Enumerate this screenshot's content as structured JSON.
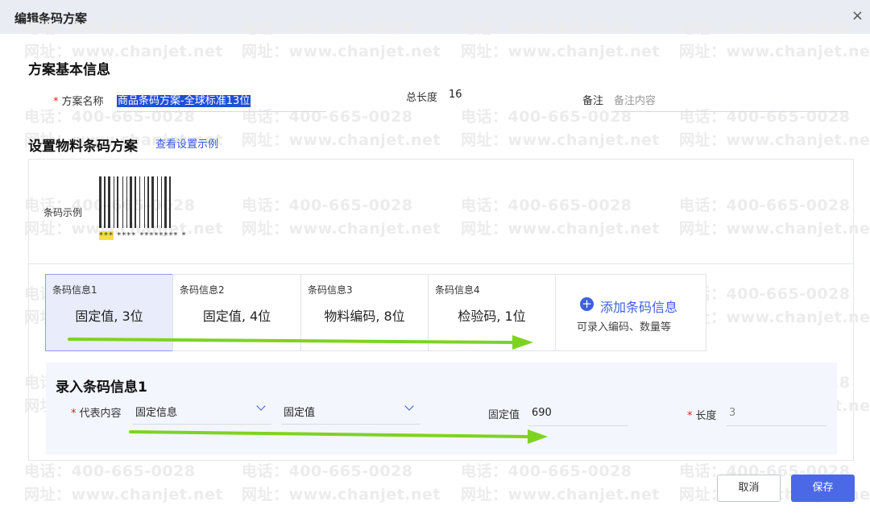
{
  "dialog": {
    "title": "编辑条码方案",
    "close_glyph": "×"
  },
  "watermark": {
    "phone": "电话：400-665-0028",
    "site": "网址：www.chanjet.net"
  },
  "basic": {
    "heading": "方案基本信息",
    "name_label": "方案名称",
    "name_value": "商品条码方案-全球标准13位",
    "total_length_label": "总长度",
    "total_length_value": "16",
    "remark_label": "备注",
    "remark_placeholder": "备注内容"
  },
  "setup": {
    "heading": "设置物料条码方案",
    "example_link": "查看设置示例",
    "barcode_example_label": "条码示例",
    "barcode_text_highlight": "***",
    "barcode_text_rest": "**** ******** *"
  },
  "segments": [
    {
      "title": "条码信息1",
      "summary": "固定值, 3位"
    },
    {
      "title": "条码信息2",
      "summary": "固定值, 4位"
    },
    {
      "title": "条码信息3",
      "summary": "物料编码, 8位"
    },
    {
      "title": "条码信息4",
      "summary": "检验码, 1位"
    }
  ],
  "add_segment": {
    "icon": "plus-circle-icon",
    "label": "添加条码信息",
    "hint": "可录入编码、数量等"
  },
  "entry": {
    "heading": "录入条码信息1",
    "content_label": "代表内容",
    "content_type": "固定信息",
    "content_subtype": "固定值",
    "fixed_label": "固定值",
    "fixed_value": "690",
    "length_label": "长度",
    "length_value": "3"
  },
  "footer": {
    "cancel": "取消",
    "save": "保存"
  },
  "colors": {
    "accent": "#4b68e6",
    "arrow": "#7ed321",
    "selected_card": "#e8ecfb",
    "highlight": "#f5e046"
  }
}
